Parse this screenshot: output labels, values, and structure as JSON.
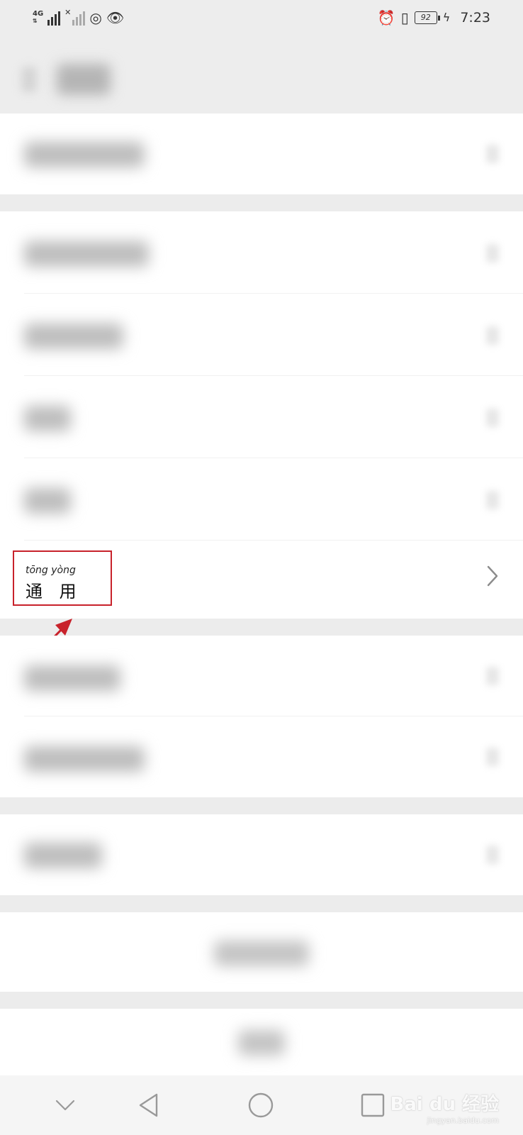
{
  "status_bar": {
    "network": "4G",
    "battery_level": "92",
    "time": "7:23",
    "icons": [
      "signal-icon",
      "signal-off-icon",
      "hotspot-icon",
      "eye-comfort-icon",
      "alarm-icon",
      "vibrate-icon",
      "battery-icon",
      "charging-icon"
    ]
  },
  "focus_item": {
    "pinyin": "tōng yòng",
    "hanzi": "通 用"
  },
  "watermark": {
    "main": "Bai du 经验",
    "sub": "jingyan.baidu.com"
  },
  "colors": {
    "highlight": "#c8222b",
    "background": "#ececec",
    "row": "#ffffff"
  }
}
